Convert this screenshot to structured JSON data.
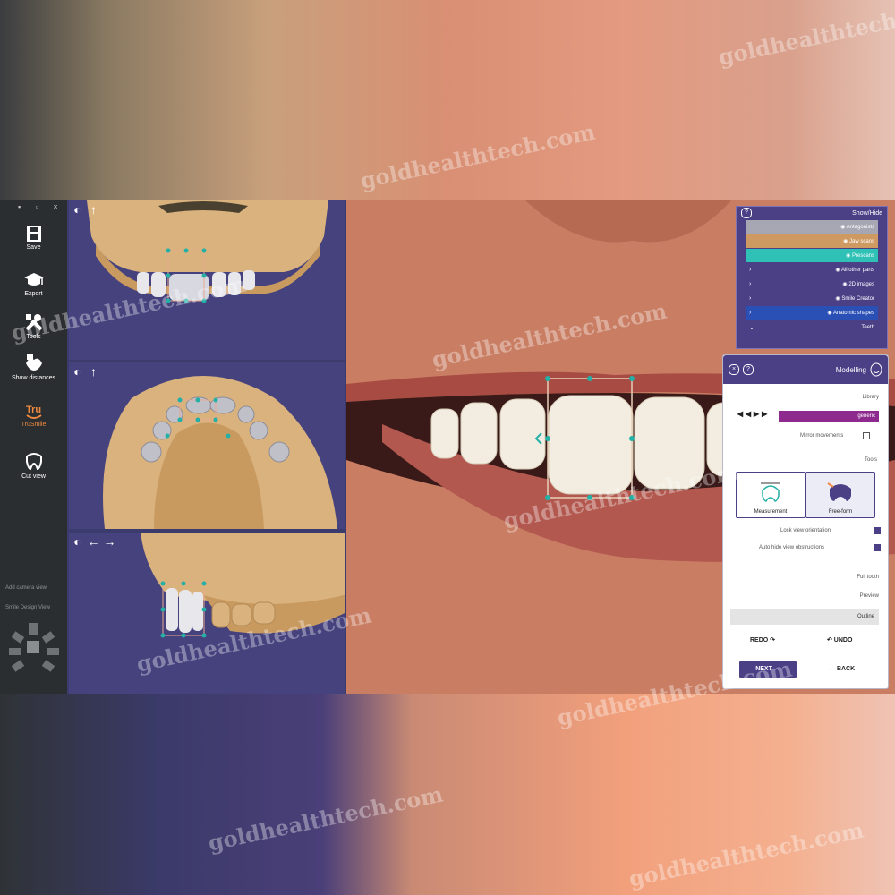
{
  "toolbar": {
    "top_icons": "▪ ▫ ×",
    "tools": [
      {
        "label": "Save",
        "icon": "save-icon"
      },
      {
        "label": "Export",
        "icon": "export-icon"
      },
      {
        "label": "Tools",
        "icon": "tools-icon"
      },
      {
        "label": "Show distances",
        "icon": "distances-icon"
      },
      {
        "label": "TruSmile",
        "icon": "trusmile-icon",
        "active": true
      },
      {
        "label": "Cut view",
        "icon": "cut-view-icon"
      }
    ],
    "links": [
      "Add camera view",
      "Smile Design View"
    ],
    "logo_icon": "app-logo-icon"
  },
  "viewports": [
    {
      "controls": [
        "◐",
        "↑"
      ]
    },
    {
      "controls": [
        "◐",
        "↑"
      ]
    },
    {
      "controls": [
        "◐",
        "←",
        "→"
      ]
    }
  ],
  "show_hide": {
    "title": "Show/Hide",
    "help": "?",
    "rows": [
      {
        "label": "Antagonists",
        "color": "#a7a7b3",
        "eye": true,
        "chevron": ""
      },
      {
        "label": "Jaw scans",
        "color": "#cf9a62",
        "eye": true,
        "chevron": ""
      },
      {
        "label": "Prescans",
        "color": "#2fc1b6",
        "eye": true,
        "chevron": ""
      },
      {
        "label": "All other parts",
        "color": "#4b3f86",
        "eye": true,
        "chevron": "›"
      },
      {
        "label": "2D images",
        "color": "#4b3f86",
        "eye": true,
        "chevron": "›"
      },
      {
        "label": "Smile Creator",
        "color": "#4b3f86",
        "eye": true,
        "chevron": "›"
      },
      {
        "label": "Anatomic shapes",
        "color": "#2a4fb5",
        "eye": true,
        "chevron": "›"
      },
      {
        "label": "Teeth",
        "color": "#4b3f86",
        "eye": false,
        "chevron": "⌄"
      }
    ]
  },
  "modelling": {
    "title": "Modelling",
    "library_label": "Library",
    "library_value": "generic",
    "mirror_label": "Mirror movements",
    "tools_label": "Tools",
    "tool_cards": [
      {
        "label": "Free-form",
        "selected": true
      },
      {
        "label": "Measurement",
        "selected": false
      }
    ],
    "lock_view_label": "Lock view orientation",
    "auto_hide_label": "Auto hide view obstructions",
    "full_tooth": "Full tooth",
    "preview": "Preview",
    "outline": "Outline",
    "undo": "↶ UNDO",
    "redo": "REDO ↷",
    "back": "← BACK",
    "next": "NEXT →"
  },
  "watermark": "goldhealthtech.com",
  "colors": {
    "accent": "#4b3f86",
    "handle": "#23b0a6",
    "generic": "#8e2a8e",
    "active_tool": "#f08a40"
  }
}
